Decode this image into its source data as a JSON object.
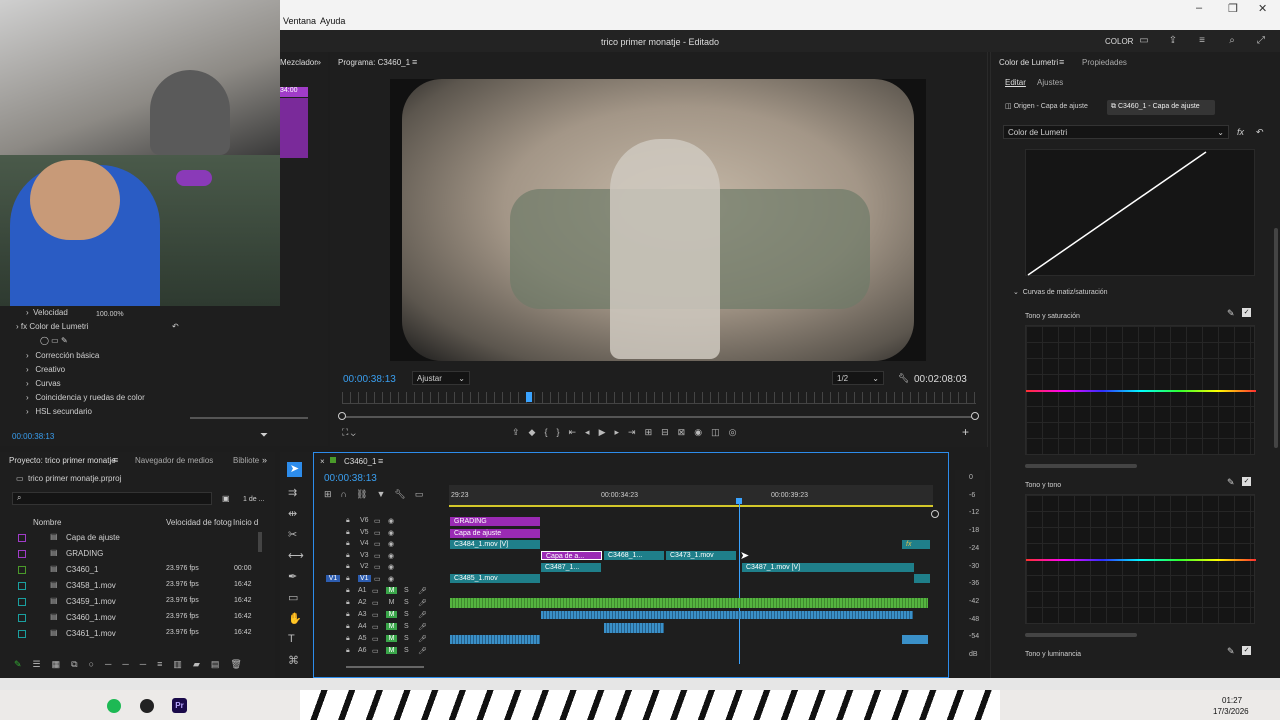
{
  "menu": {
    "items": [
      "Ventana",
      "Ayuda"
    ]
  },
  "window": {
    "title": "trico primer monatje - Editado",
    "workspace": "COLOR"
  },
  "source_panel": {
    "tab_label": "Mezclador",
    "timecode": "00:00:38:13",
    "effects": [
      "Velocidad",
      "Color de Lumetri"
    ],
    "speed_value": "100.00%",
    "lumetri_sections": [
      "Corrección básica",
      "Creativo",
      "Curvas",
      "Coincidencia y ruedas de color",
      "HSL secundario"
    ],
    "partial_timecode": "34:00"
  },
  "program": {
    "title": "Programa: C3460_1",
    "timecode": "00:00:38:13",
    "fit": "Ajustar",
    "resolution": "1/2",
    "duration": "00:02:08:03"
  },
  "project": {
    "tabs": [
      "Proyecto: trico primer monatje",
      "Navegador de medios",
      "Bibliote"
    ],
    "file": "trico primer monatje.prproj",
    "count": "1 de ...",
    "columns": [
      "Nombre",
      "Velocidad de fotog",
      "Inicio d"
    ],
    "items": [
      {
        "name": "Capa de ajuste",
        "fps": "",
        "start": "",
        "color": "#a03cc8"
      },
      {
        "name": "GRADING",
        "fps": "",
        "start": "",
        "color": "#a03cc8"
      },
      {
        "name": "C3460_1",
        "fps": "23.976 fps",
        "start": "00:00",
        "color": "#4a9a2a"
      },
      {
        "name": "C3458_1.mov",
        "fps": "23.976 fps",
        "start": "16:42",
        "color": "#1aa0a0"
      },
      {
        "name": "C3459_1.mov",
        "fps": "23.976 fps",
        "start": "16:42",
        "color": "#1aa0a0"
      },
      {
        "name": "C3460_1.mov",
        "fps": "23.976 fps",
        "start": "16:42",
        "color": "#1aa0a0"
      },
      {
        "name": "C3461_1.mov",
        "fps": "23.976 fps",
        "start": "16:42",
        "color": "#1aa0a0"
      }
    ]
  },
  "timeline": {
    "tab": "C3460_1",
    "timecode": "00:00:38:13",
    "ruler": [
      "29:23",
      "00:00:34:23",
      "00:00:39:23"
    ],
    "video_tracks": [
      "V6",
      "V5",
      "V4",
      "V3",
      "V2",
      "V1"
    ],
    "audio_tracks": [
      "A1",
      "A2",
      "A3",
      "A4",
      "A5",
      "A6"
    ],
    "clips": {
      "grading": "GRADING",
      "adjust": "Capa de ajuste",
      "v4": "C3484_1.mov [V]",
      "v3a": "Capa de a...",
      "v3b": "C3468_1...",
      "v3c": "C3473_1.mov",
      "v2a": "C3487_1...",
      "v2b": "C3487_1.mov [V]",
      "v1": "C3485_1.mov",
      "fx": "fx"
    },
    "meter": [
      "0",
      "-6",
      "-12",
      "-18",
      "-24",
      "-30",
      "-36",
      "-42",
      "-48",
      "-54",
      "dB"
    ]
  },
  "lumetri": {
    "tabs": [
      "Color de Lumetri",
      "Propiedades"
    ],
    "subtabs": [
      "Editar",
      "Ajustes"
    ],
    "source": "Origen - Capa de ajuste",
    "target": "C3460_1 - Capa de ajuste",
    "effect_select": "Color de Lumetri",
    "section": "Curvas de matiz/saturación",
    "curves": [
      "Tono y saturación",
      "Tono y tono",
      "Tono y luminancia"
    ]
  },
  "taskbar": {
    "time": "01:27",
    "date": "17/3/2026"
  },
  "colors": {
    "accent": "#2d8ceb",
    "playhead": "#3aa3ff",
    "purple": "#a03cc8",
    "teal": "#1f7f8a",
    "audio_green": "#55b540",
    "audio_blue": "#3a90c8"
  }
}
